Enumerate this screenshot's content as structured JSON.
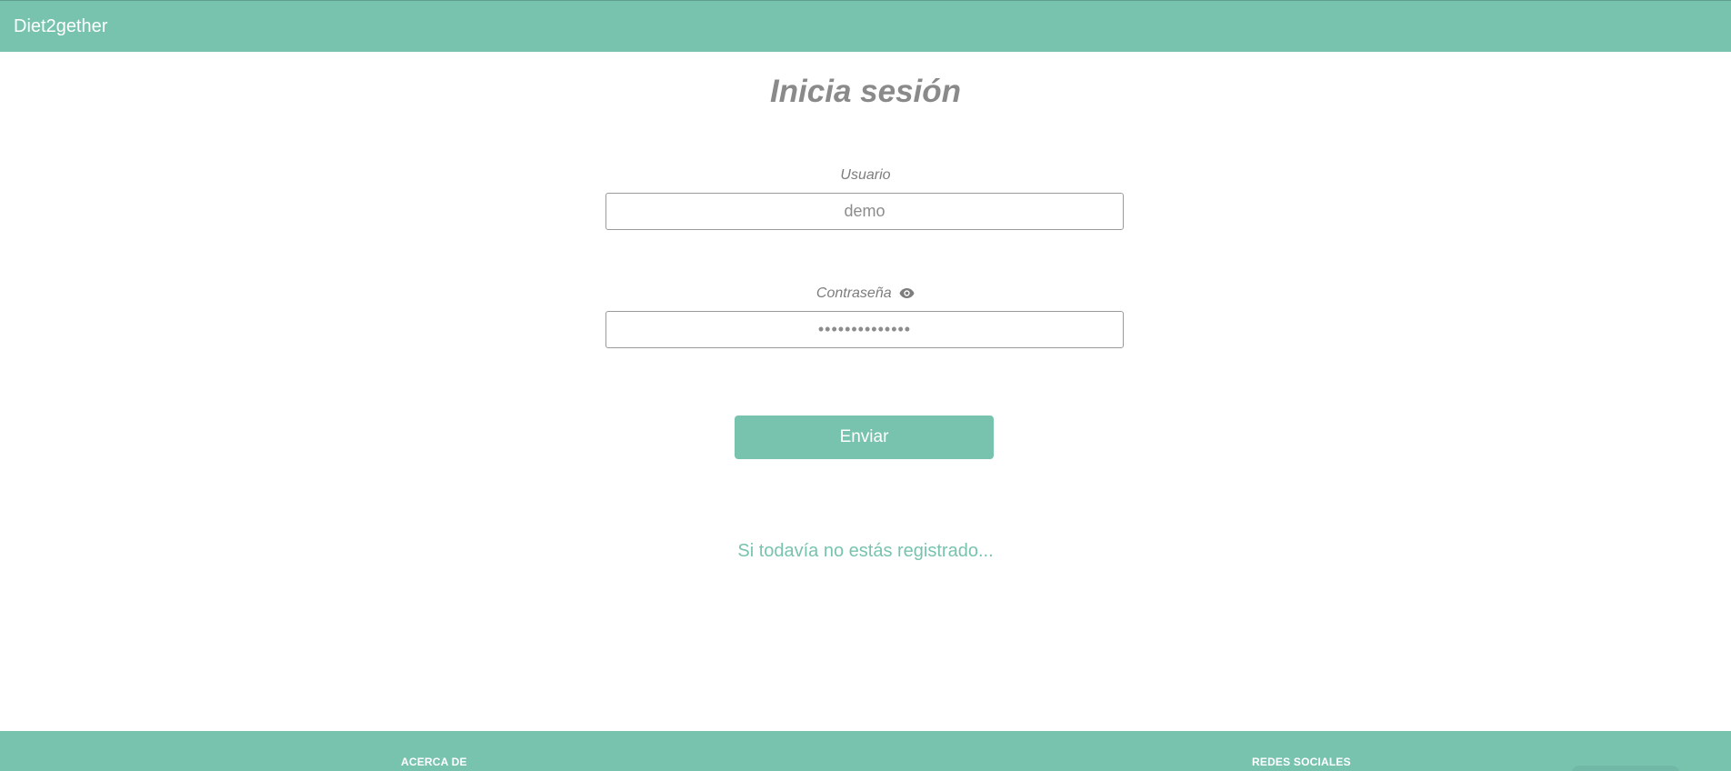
{
  "navbar": {
    "brand": "Diet2gether",
    "accent_color": "#78c3ae"
  },
  "login": {
    "title": "Inicia sesión",
    "username_label": "Usuario",
    "username_value": "demo",
    "password_label": "Contraseña",
    "password_icon": "eye-icon",
    "password_value": "••••••••••••••",
    "submit_label": "Enviar",
    "register_link": "Si todavía no estás registrado..."
  },
  "footer": {
    "about_heading": "ACERCA DE",
    "social_heading": "REDES SOCIALES"
  }
}
